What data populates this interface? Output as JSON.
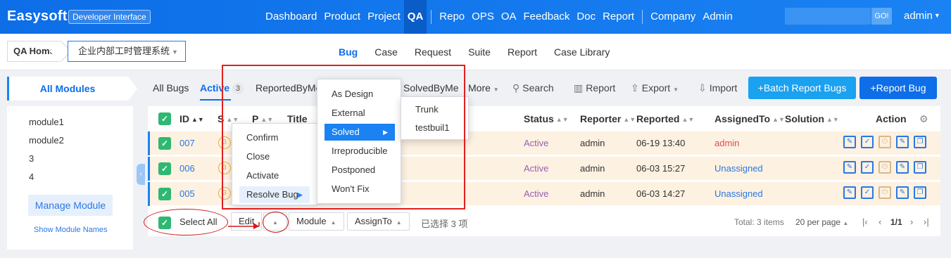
{
  "topbar": {
    "brand": "Easysoft",
    "badge": "Developer Interface",
    "nav": [
      "Dashboard",
      "Product",
      "Project",
      "QA",
      "Repo",
      "OPS",
      "OA",
      "Feedback",
      "Doc",
      "Report",
      "Company",
      "Admin"
    ],
    "active_nav": "QA",
    "go_label": "GO!",
    "user": "admin"
  },
  "subbar": {
    "crumb_home": "QA Home",
    "crumb_product": "企业内部工时管理系统",
    "tabs": [
      "Bug",
      "Case",
      "Request",
      "Suite",
      "Report",
      "Case Library"
    ],
    "active_tab": "Bug"
  },
  "sidebar": {
    "title": "All Modules",
    "modules": [
      "module1",
      "module2",
      "3",
      "4"
    ],
    "manage_label": "Manage Module",
    "show_names_label": "Show Module Names"
  },
  "featurebar": {
    "all_bugs": "All Bugs",
    "active": "Active",
    "active_count": "3",
    "reported_by_me": "ReportedByMe",
    "solved_by_me": "SolvedByMe",
    "more": "More",
    "search": "Search",
    "report": "Report",
    "export": "Export",
    "import": "Import",
    "batch_report": "Batch Report Bugs",
    "report_bug": "Report Bug"
  },
  "table": {
    "headers": {
      "id": "ID",
      "severity": "S",
      "priority": "P",
      "title": "Title",
      "status": "Status",
      "reporter": "Reporter",
      "reported": "Reported",
      "assigned": "AssignedTo",
      "solution": "Solution",
      "action": "Action"
    },
    "rows": [
      {
        "id": "007",
        "severity": "3",
        "status": "Active",
        "reporter": "admin",
        "reported": "06-19 13:40",
        "assigned": "admin"
      },
      {
        "id": "006",
        "severity": "3",
        "status": "Active",
        "reporter": "admin",
        "reported": "06-03 15:27",
        "assigned": "Unassigned"
      },
      {
        "id": "005",
        "severity": "3",
        "status": "Active",
        "reporter": "admin",
        "reported": "06-03 14:27",
        "assigned": "Unassigned"
      }
    ]
  },
  "footer": {
    "select_all": "Select All",
    "edit": "Edit",
    "module": "Module",
    "assign_to": "AssignTo",
    "selected_text": "已选择 3 项",
    "total": "Total: 3 items",
    "per_page": "20 per page",
    "page": "1/1"
  },
  "menus": {
    "batch": [
      "Confirm",
      "Close",
      "Activate",
      "Resolve Bug"
    ],
    "resolution": [
      "As Design",
      "External",
      "Solved",
      "Irreproducible",
      "Postponed",
      "Won't Fix"
    ],
    "build": [
      "Trunk",
      "testbuil1"
    ]
  },
  "colors": {
    "accent": "#1a82f2",
    "row_highlight": "#fdf1e1",
    "annotation_red": "#e02020",
    "status_active": "#9a5fb4"
  }
}
